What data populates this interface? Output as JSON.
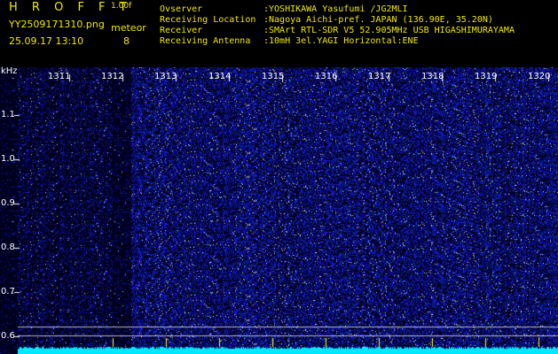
{
  "header": {
    "title": "H R O F F T",
    "version": "1.00f",
    "filename": "YY2509171310.png",
    "datetime": "25.09.17 13:10",
    "meteor_label": "meteor",
    "meteor_count": "8"
  },
  "info": [
    {
      "key": "Ovserver",
      "value": ":YOSHIKAWA Yasufumi /JG2MLI"
    },
    {
      "key": "Receiving Location",
      "value": ":Nagoya Aichi-pref. JAPAN (136.90E, 35.20N)"
    },
    {
      "key": "Receiver",
      "value": ":SMArt RTL-SDR V5 52.905MHz USB HIGASHIMURAYAMA"
    },
    {
      "key": "Receiving Antenna",
      "value": ":10mH 3el.YAGI Horizontal:ENE"
    }
  ],
  "axis": {
    "unit": "kHz",
    "minute_labels": [
      "1311",
      "1312",
      "1313",
      "1314",
      "1315",
      "1316",
      "1317",
      "1318",
      "1319",
      "1320"
    ],
    "freq_labels": [
      "1.1",
      "1.0",
      "0.9",
      "0.8",
      "0.7",
      "0.6"
    ]
  },
  "colors": {
    "header_text": "#f0e800",
    "spectrogram_bg": "#000033",
    "noise": "#2233ff",
    "baseline": "#00e8ff"
  }
}
